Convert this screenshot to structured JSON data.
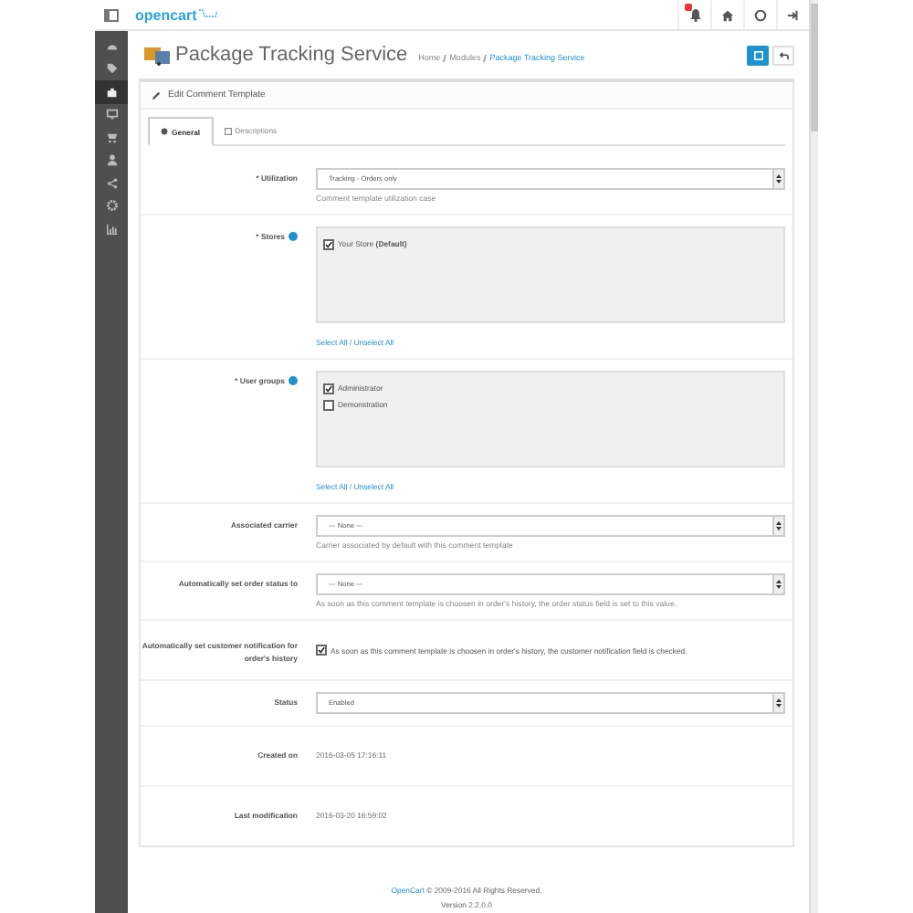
{
  "topbar": {
    "logo": "opencart",
    "alert": true
  },
  "sidebar": {
    "items": [
      {
        "selected": false
      },
      {
        "selected": false
      },
      {
        "selected": true
      },
      {
        "selected": false
      },
      {
        "selected": false
      },
      {
        "selected": false
      },
      {
        "selected": false
      },
      {
        "selected": false
      },
      {
        "selected": false
      }
    ]
  },
  "page": {
    "title": "Package Tracking Service",
    "breadcrumb": [
      "Home",
      "Modules",
      "Package Tracking Service"
    ]
  },
  "panel": {
    "heading": "Edit Comment Template",
    "tabs": [
      {
        "label": "General",
        "selected": true
      },
      {
        "label": "Descriptions",
        "selected": false
      }
    ],
    "fields": [
      {
        "kind": "select",
        "label": "* Utilization",
        "value": "Tracking - Orders only",
        "help": "Comment template utilization case"
      },
      {
        "kind": "checklist",
        "label": "* Stores",
        "info": true,
        "options": [
          {
            "label": "Your Store **(Default)**",
            "checked": true
          }
        ],
        "link": "Select All / Unselect All"
      },
      {
        "kind": "checklist",
        "label": "* User groups",
        "info": true,
        "options": [
          {
            "label": "Administrator",
            "checked": true
          },
          {
            "label": "Demonstration",
            "checked": false
          }
        ],
        "link": "Select All / Unselect All"
      },
      {
        "kind": "select",
        "label": "Associated carrier",
        "value": "--- None ---",
        "help": "Carrier associated by default with this comment template"
      },
      {
        "kind": "select",
        "label": "Automatically set order status to",
        "value": "--- None ---",
        "help": "As soon as this comment template is choosen in order's history, the order status field is set to this value."
      },
      {
        "kind": "checkbox",
        "label": "Automatically set customer notification for order's history",
        "checked": true,
        "text": "As soon as this comment template is choosen in order's history, the customer notification field is checked."
      },
      {
        "kind": "select",
        "label": "Status",
        "value": "Enabled"
      },
      {
        "kind": "text",
        "label": "Created on",
        "value": "2016-03-05 17:16:11"
      },
      {
        "kind": "text",
        "label": "Last modification",
        "value": "2016-03-20 16:59:02"
      }
    ]
  },
  "footer": {
    "link": "OpenCart",
    "text": " © 2009-2016 All Rights Reserved.",
    "version": "Version 2.2.0.0"
  }
}
